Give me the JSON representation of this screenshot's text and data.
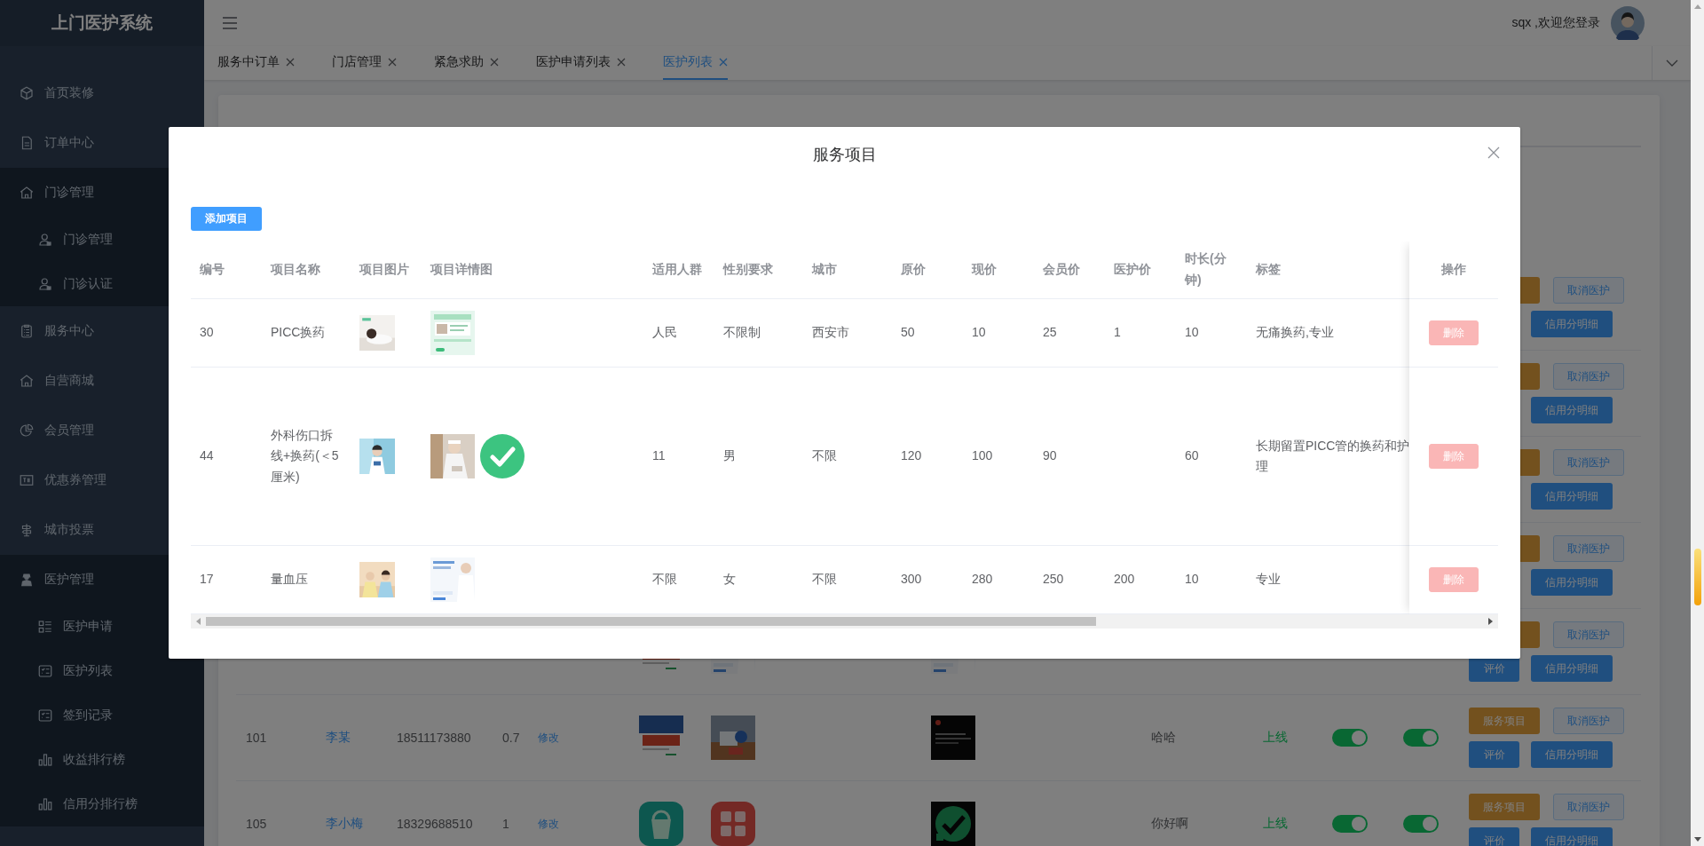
{
  "sidebar": {
    "title": "上门医护系统",
    "items": [
      {
        "label": "首页装修"
      },
      {
        "label": "订单中心"
      },
      {
        "label": "门诊管理",
        "expanded": true,
        "children": [
          {
            "label": "门诊管理"
          },
          {
            "label": "门诊认证"
          }
        ]
      },
      {
        "label": "服务中心"
      },
      {
        "label": "自营商城"
      },
      {
        "label": "会员管理"
      },
      {
        "label": "优惠券管理"
      },
      {
        "label": "城市投票"
      },
      {
        "label": "医护管理",
        "expanded": true,
        "children": [
          {
            "label": "医护申请"
          },
          {
            "label": "医护列表"
          },
          {
            "label": "签到记录"
          },
          {
            "label": "收益排行榜"
          },
          {
            "label": "信用分排行榜"
          }
        ]
      }
    ]
  },
  "header": {
    "greeting": "sqx ,欢迎您登录"
  },
  "tabs": [
    {
      "label": "服务中订单",
      "selected": false
    },
    {
      "label": "门店管理",
      "selected": false
    },
    {
      "label": "紧急求助",
      "selected": false
    },
    {
      "label": "医护申请列表",
      "selected": false
    },
    {
      "label": "医护列表",
      "selected": true
    }
  ],
  "page_table": {
    "rows": [
      {
        "actions": [
          {
            "kind": "service"
          },
          {
            "kind": "cancel",
            "label": "取消医护"
          },
          {
            "kind": "credit",
            "label": "信用分明细"
          }
        ]
      },
      {
        "actions": [
          {
            "kind": "service"
          },
          {
            "kind": "cancel",
            "label": "取消医护"
          },
          {
            "kind": "credit",
            "label": "信用分明细"
          }
        ]
      },
      {
        "actions": [
          {
            "kind": "service"
          },
          {
            "kind": "cancel",
            "label": "取消医护"
          },
          {
            "kind": "credit",
            "label": "信用分明细"
          }
        ]
      },
      {
        "actions": [
          {
            "kind": "service"
          },
          {
            "kind": "cancel",
            "label": "取消医护"
          },
          {
            "kind": "credit",
            "label": "信用分明细"
          }
        ]
      },
      {
        "images": [
          {
            "kind": "picture"
          },
          {
            "kind": "picture"
          }
        ],
        "detail_image": {
          "kind": "picture"
        },
        "actions": [
          {
            "kind": "service"
          },
          {
            "kind": "cancel",
            "label": "取消医护"
          },
          {
            "kind": "rate",
            "label": "评价"
          },
          {
            "kind": "credit",
            "label": "信用分明细"
          }
        ]
      },
      {
        "id": "101",
        "name": "李某",
        "phone": "18511173880",
        "ratio": "0.7",
        "edit": "修改",
        "images": [
          {
            "kind": "picture"
          },
          {
            "kind": "picture"
          }
        ],
        "detail_image": {
          "kind": "picture"
        },
        "remark": "哈哈",
        "status": "上线",
        "switch_1": {
          "on": true
        },
        "switch_2": {
          "on": true
        },
        "actions": [
          {
            "kind": "service",
            "label": "服务项目"
          },
          {
            "kind": "cancel",
            "label": "取消医护"
          },
          {
            "kind": "rate",
            "label": "评价"
          },
          {
            "kind": "credit",
            "label": "信用分明细"
          }
        ]
      },
      {
        "id": "105",
        "name": "李小梅",
        "phone": "18329688510",
        "ratio": "1",
        "edit": "修改",
        "images": [
          {
            "kind": "picture"
          },
          {
            "kind": "picture"
          }
        ],
        "detail_image": {
          "kind": "picture"
        },
        "remark": "你好啊",
        "status": "上线",
        "switch_1": {
          "on": true
        },
        "switch_2": {
          "on": true
        },
        "actions": [
          {
            "kind": "service",
            "label": "服务项目"
          },
          {
            "kind": "cancel",
            "label": "取消医护"
          },
          {
            "kind": "rate",
            "label": "评价"
          },
          {
            "kind": "credit",
            "label": "信用分明细"
          }
        ]
      }
    ]
  },
  "dialog": {
    "title": "服务项目",
    "add_button": "添加项目",
    "columns": [
      "编号",
      "项目名称",
      "项目图片",
      "项目详情图",
      "适用人群",
      "性别要求",
      "城市",
      "原价",
      "现价",
      "会员价",
      "医护价",
      "时长(分钟)",
      "标签"
    ],
    "action_column": "操作",
    "rows": [
      {
        "id": "30",
        "name": "PICC换药",
        "picture": {
          "kind": "picture"
        },
        "detail_images": [
          {
            "kind": "picture"
          }
        ],
        "audience": "人民",
        "gender": "不限制",
        "city": "西安市",
        "original_price": "50",
        "price": "10",
        "member_price": "25",
        "nurse_price": "1",
        "duration": "10",
        "tags": "无痛换药,专业",
        "action": "删除"
      },
      {
        "id": "44",
        "name": "外科伤口拆线+换药(＜5厘米)",
        "picture": {
          "kind": "picture"
        },
        "detail_images": [
          {
            "kind": "picture"
          },
          {
            "kind": "check"
          }
        ],
        "audience": "11",
        "gender": "男",
        "city": "不限",
        "original_price": "120",
        "price": "100",
        "member_price": "90",
        "duration": "60",
        "tags": "长期留置PICC管的换药和护理",
        "action": "删除"
      },
      {
        "id": "17",
        "name": "量血压",
        "picture": {
          "kind": "picture"
        },
        "detail_images": [
          {
            "kind": "picture"
          }
        ],
        "audience": "不限",
        "gender": "女",
        "city": "不限",
        "original_price": "300",
        "price": "280",
        "member_price": "250",
        "nurse_price": "200",
        "duration": "10",
        "tags": "专业",
        "action": "删除"
      }
    ]
  }
}
